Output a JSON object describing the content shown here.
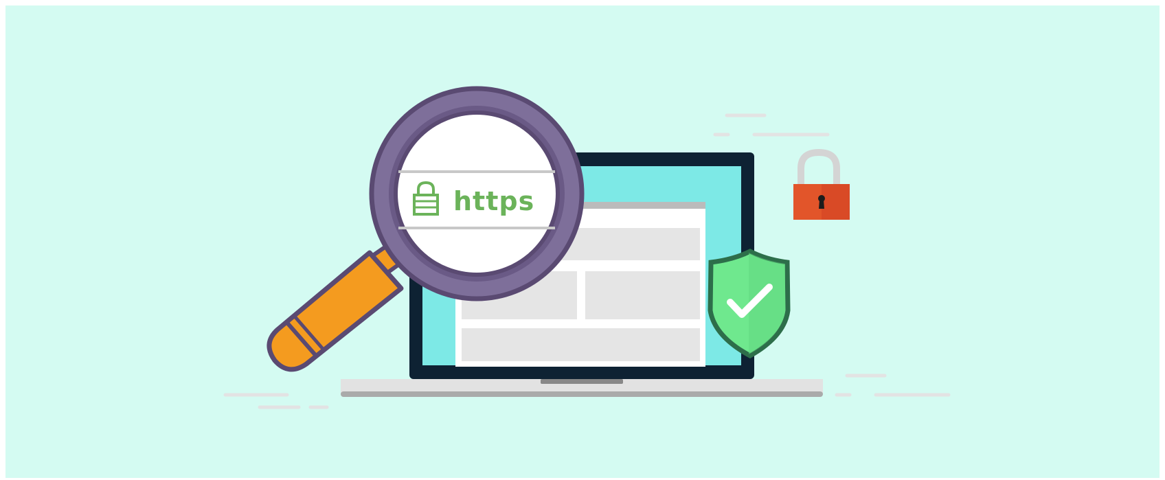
{
  "illustration": {
    "url_scheme_text": "https",
    "icons": {
      "magnifier": "magnifying-glass-icon",
      "laptop": "laptop-icon",
      "padlock": "padlock-icon",
      "small_lock": "lock-icon",
      "shield": "shield-check-icon"
    },
    "colors": {
      "background": "#d4fbf2",
      "laptop_frame": "#0e2233",
      "laptop_screen": "#7de9e6",
      "magnifier_ring": "#7e6f9a",
      "magnifier_outline": "#5a4a72",
      "magnifier_handle": "#f49b1f",
      "https_text": "#6bb35a",
      "padlock_body": "#e2552a",
      "shield_fill": "#6fe88e",
      "shield_outline": "#2d6e4a"
    }
  }
}
